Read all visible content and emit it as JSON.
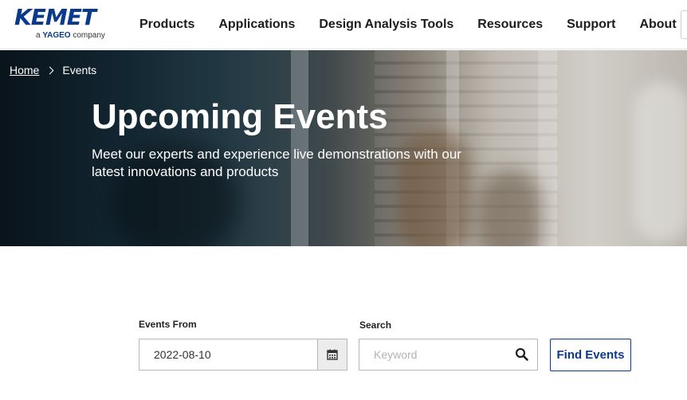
{
  "brand": {
    "name": "KEMET",
    "tagline_prefix": "a ",
    "tagline_brand": "YAGEO",
    "tagline_suffix": " company",
    "color": "#0a3a8c"
  },
  "nav": {
    "items": [
      {
        "label": "Products"
      },
      {
        "label": "Applications"
      },
      {
        "label": "Design Analysis Tools"
      },
      {
        "label": "Resources"
      },
      {
        "label": "Support"
      },
      {
        "label": "About"
      }
    ]
  },
  "breadcrumb": {
    "home": "Home",
    "current": "Events"
  },
  "hero": {
    "title": "Upcoming Events",
    "subtitle": "Meet our experts and experience live demonstrations with our latest innovations and products"
  },
  "filters": {
    "events_from_label": "Events From",
    "events_from_value": "2022-08-10",
    "search_label": "Search",
    "search_placeholder": "Keyword",
    "search_value": "",
    "find_button": "Find Events"
  },
  "icons": {
    "calendar": "calendar-icon",
    "search": "search-icon",
    "breadcrumb_separator": "chevron-right-icon"
  }
}
